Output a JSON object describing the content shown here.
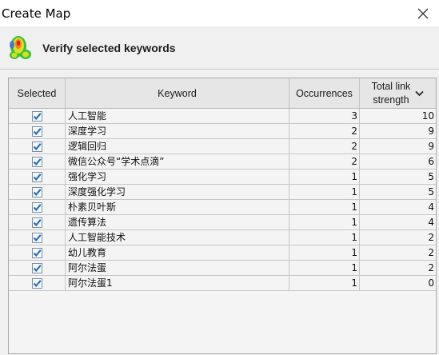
{
  "window": {
    "title": "Create Map"
  },
  "header": {
    "title": "Verify selected keywords"
  },
  "table": {
    "columns": {
      "selected": "Selected",
      "keyword": "Keyword",
      "occurrences": "Occurrences",
      "total_link_strength_line1": "Total link",
      "total_link_strength_line2": "strength"
    },
    "sort": {
      "column": "Total link strength",
      "direction": "descending"
    },
    "rows": [
      {
        "selected": true,
        "keyword": "人工智能",
        "occurrences": "3",
        "total_link_strength": "10"
      },
      {
        "selected": true,
        "keyword": "深度学习",
        "occurrences": "2",
        "total_link_strength": "9"
      },
      {
        "selected": true,
        "keyword": "逻辑回归",
        "occurrences": "2",
        "total_link_strength": "9"
      },
      {
        "selected": true,
        "keyword": "微信公众号“学术点滴”",
        "occurrences": "2",
        "total_link_strength": "6"
      },
      {
        "selected": true,
        "keyword": "强化学习",
        "occurrences": "1",
        "total_link_strength": "5"
      },
      {
        "selected": true,
        "keyword": "深度强化学习",
        "occurrences": "1",
        "total_link_strength": "5"
      },
      {
        "selected": true,
        "keyword": "朴素贝叶斯",
        "occurrences": "1",
        "total_link_strength": "4"
      },
      {
        "selected": true,
        "keyword": "遗传算法",
        "occurrences": "1",
        "total_link_strength": "4"
      },
      {
        "selected": true,
        "keyword": "人工智能技术",
        "occurrences": "1",
        "total_link_strength": "2"
      },
      {
        "selected": true,
        "keyword": "幼儿教育",
        "occurrences": "1",
        "total_link_strength": "2"
      },
      {
        "selected": true,
        "keyword": "阿尔法蛋",
        "occurrences": "1",
        "total_link_strength": "2"
      },
      {
        "selected": true,
        "keyword": "阿尔法蛋1",
        "occurrences": "1",
        "total_link_strength": "0"
      }
    ]
  },
  "icons": {
    "close": "close-icon",
    "app_logo": "vosviewer-density-logo-icon",
    "sort": "chevron-down-icon",
    "checkbox": "checkbox-checked-icon"
  },
  "colors": {
    "window_background": "#f0f0f0",
    "titlebar_background": "#ffffff",
    "table_header_background": "#e6e6e6",
    "checkbox_check": "#2b6fb6"
  }
}
